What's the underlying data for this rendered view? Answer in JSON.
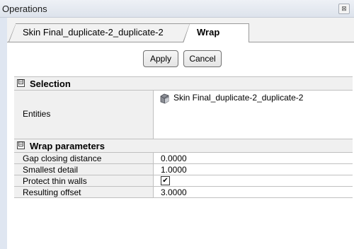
{
  "window": {
    "title": "Operations",
    "close_glyph": "⊠"
  },
  "tabs": [
    {
      "label": "Skin Final_duplicate-2_duplicate-2",
      "active": false
    },
    {
      "label": "Wrap",
      "active": true
    }
  ],
  "actions": {
    "apply_label": "Apply",
    "cancel_label": "Cancel"
  },
  "sections": {
    "selection": {
      "toggle": "⊟",
      "label": "Selection",
      "entities_label": "Entities",
      "entities": [
        {
          "icon": "surface-body-icon",
          "label": "Skin Final_duplicate-2_duplicate-2"
        }
      ]
    },
    "wrap_parameters": {
      "toggle": "⊟",
      "label": "Wrap parameters",
      "rows": [
        {
          "name": "Gap closing distance",
          "value": "0.0000"
        },
        {
          "name": "Smallest detail",
          "value": "1.0000"
        },
        {
          "name": "Protect thin walls",
          "checked": true
        },
        {
          "name": "Resulting offset",
          "value": "3.0000"
        }
      ]
    }
  },
  "colors": {
    "side_stripe": "#dfe6f1",
    "category_bg": "#f0f0f0",
    "grid_line": "#c0c0c0"
  }
}
